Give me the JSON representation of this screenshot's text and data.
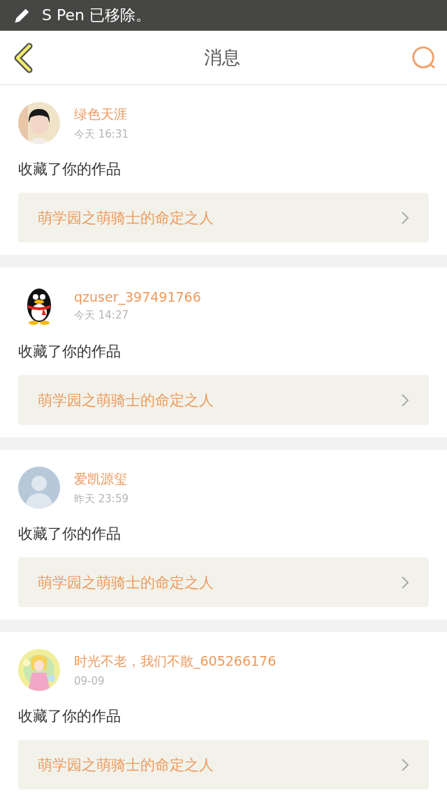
{
  "notification_bar": {
    "text": "S Pen 已移除。"
  },
  "header": {
    "title": "消息"
  },
  "messages": [
    {
      "name": "绿色天涯",
      "time": "今天 16:31",
      "action": "收藏了你的作品",
      "work": "萌学园之萌骑士的命定之人"
    },
    {
      "avatar": {
        "kind": "penguin"
      },
      "name": "qzuser_397491766",
      "time": "今天 14:27",
      "action": "收藏了你的作品",
      "work": "萌学园之萌骑士的命定之人"
    },
    {
      "avatar": {
        "kind": "default"
      },
      "name": "爱凯源玺",
      "time": "昨天 23:59",
      "action": "收藏了你的作品",
      "work": "萌学园之萌骑士的命定之人"
    },
    {
      "avatar": {
        "kind": "illustration"
      },
      "name": "时光不老，我们不散_605266176",
      "time": "09-09",
      "action": "收藏了你的作品",
      "work": "萌学园之萌骑士的命定之人"
    }
  ]
}
